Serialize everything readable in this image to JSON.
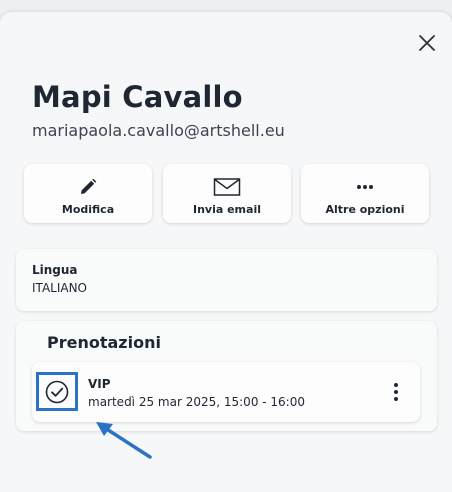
{
  "contact": {
    "name": "Mapi Cavallo",
    "email": "mariapaola.cavallo@artshell.eu"
  },
  "actions": {
    "edit_label": "Modifica",
    "email_label": "Invia email",
    "more_label": "Altre opzioni"
  },
  "language": {
    "label": "Lingua",
    "value": "ITALIANO"
  },
  "bookings": {
    "title": "Prenotazioni",
    "items": [
      {
        "name": "VIP",
        "date": "martedì 25 mar 2025, 15:00 - 16:00"
      }
    ]
  },
  "colors": {
    "highlight": "#2a72c5",
    "text": "#1f2733"
  },
  "icons": [
    "close-icon",
    "pencil-icon",
    "envelope-icon",
    "more-horizontal-icon",
    "check-circle-icon",
    "more-vertical-icon",
    "arrow-icon"
  ]
}
